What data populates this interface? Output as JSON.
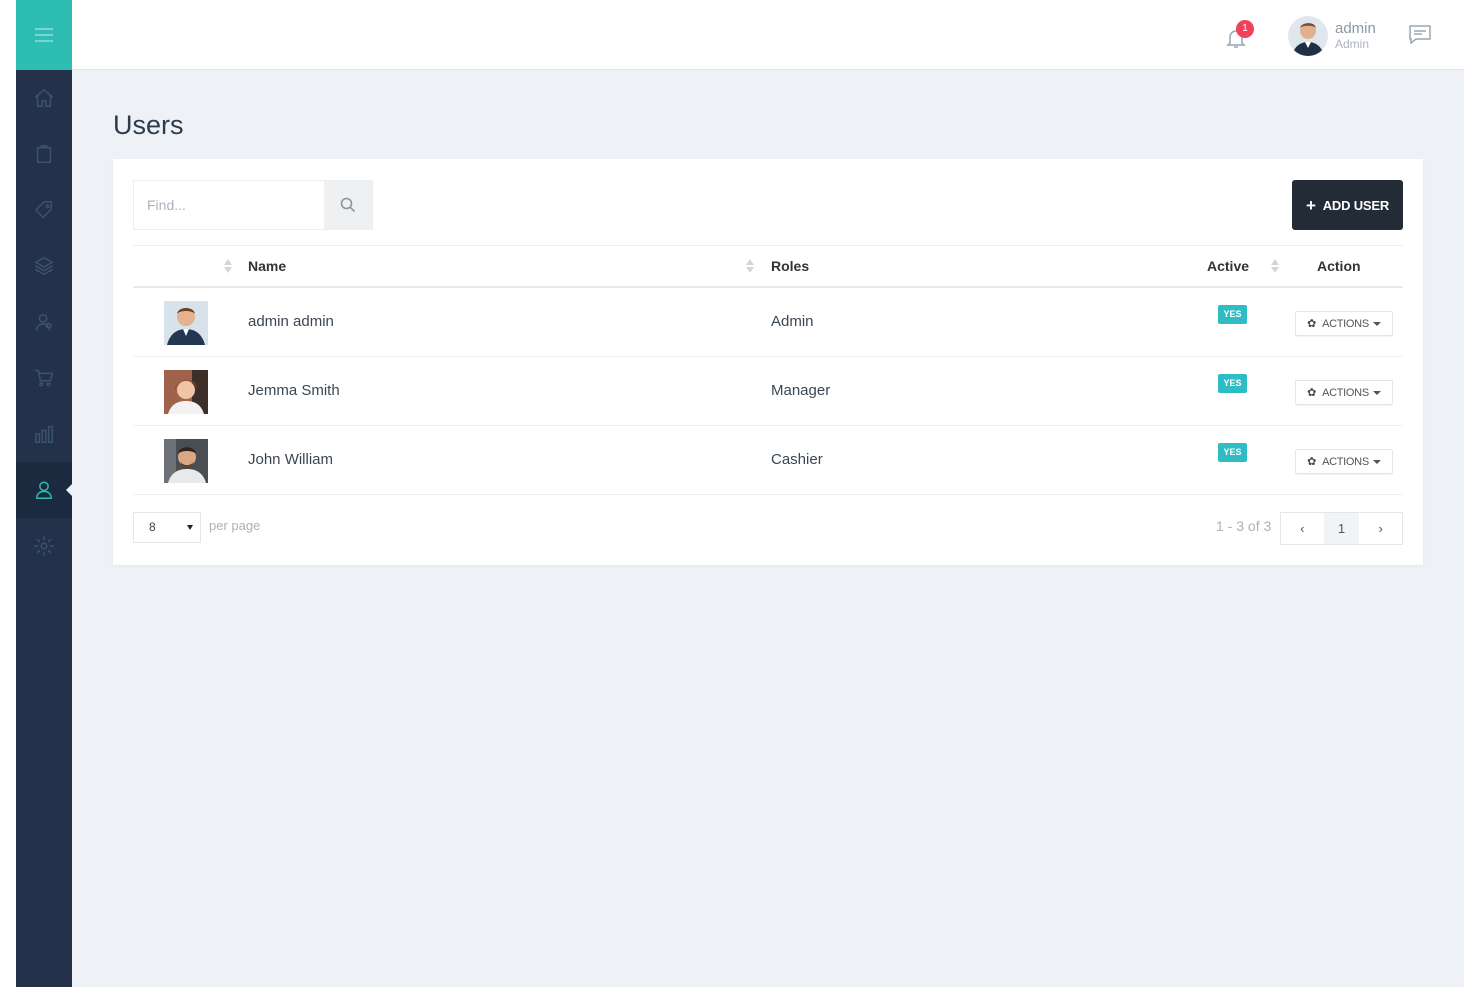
{
  "header": {
    "notification_count": "1",
    "user_name": "admin",
    "user_role": "Admin"
  },
  "sidebar": {
    "items": [
      {
        "icon": "home-icon"
      },
      {
        "icon": "clipboard-icon"
      },
      {
        "icon": "tag-icon"
      },
      {
        "icon": "layers-icon"
      },
      {
        "icon": "user-search-icon"
      },
      {
        "icon": "cart-icon"
      },
      {
        "icon": "bar-chart-icon"
      },
      {
        "icon": "user-icon",
        "active": true
      },
      {
        "icon": "gear-icon"
      }
    ]
  },
  "page": {
    "title": "Users"
  },
  "search": {
    "placeholder": "Find..."
  },
  "toolbar": {
    "add_label": "ADD USER"
  },
  "table": {
    "columns": [
      "Name",
      "Roles",
      "Active",
      "Action"
    ],
    "rows": [
      {
        "name": "admin admin",
        "role": "Admin",
        "active": "YES",
        "action": "ACTIONS"
      },
      {
        "name": "Jemma Smith",
        "role": "Manager",
        "active": "YES",
        "action": "ACTIONS"
      },
      {
        "name": "John William",
        "role": "Cashier",
        "active": "YES",
        "action": "ACTIONS"
      }
    ]
  },
  "pagination": {
    "per_page_value": "8",
    "per_page_label": "per page",
    "range": "1 - 3 of 3",
    "current_page": "1",
    "prev": "‹",
    "next": "›"
  },
  "colors": {
    "accent": "#2ebdb3",
    "sidebar": "#23324a",
    "badge": "#f0435a",
    "active_tag": "#2ebdc4",
    "primary_button": "#222b36"
  }
}
